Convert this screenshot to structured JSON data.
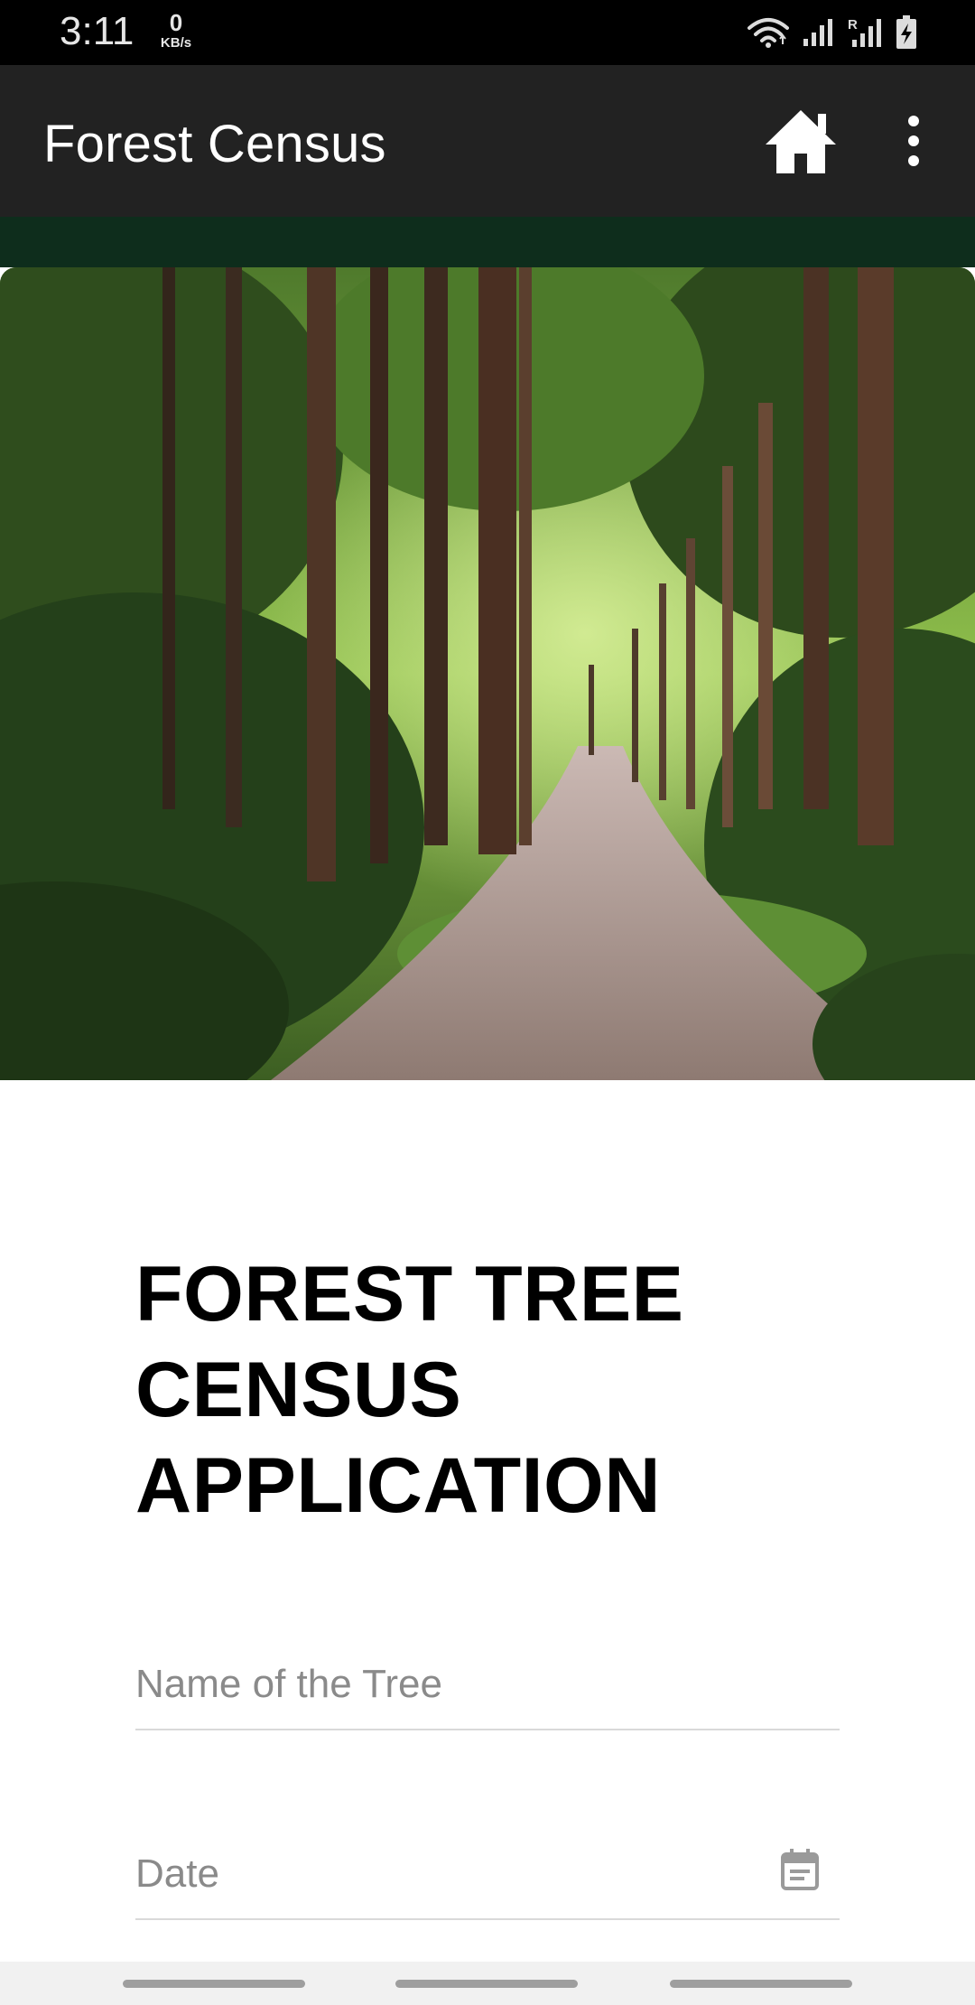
{
  "status_bar": {
    "time": "3:11",
    "net_speed_value": "0",
    "net_speed_unit": "KB/s",
    "icons": [
      "wifi-icon",
      "signal-icon",
      "signal-roaming-icon",
      "battery-charging-icon"
    ]
  },
  "app_bar": {
    "title": "Forest Census",
    "actions": [
      "home-icon",
      "more-vert-icon"
    ]
  },
  "colors": {
    "app_bar": "#222222",
    "accent_strip": "#0e2d1c",
    "status_bar": "#000000"
  },
  "hero": {
    "image": "forest-path-photo"
  },
  "main": {
    "heading": "FOREST TREE CENSUS APPLICATION",
    "form": {
      "tree_name": {
        "value": "",
        "placeholder": "Name of the Tree"
      },
      "date": {
        "value": "",
        "placeholder": "Date",
        "icon": "calendar-icon"
      }
    }
  },
  "nav_bar": {
    "handles": [
      "recent-apps",
      "home",
      "back"
    ]
  }
}
